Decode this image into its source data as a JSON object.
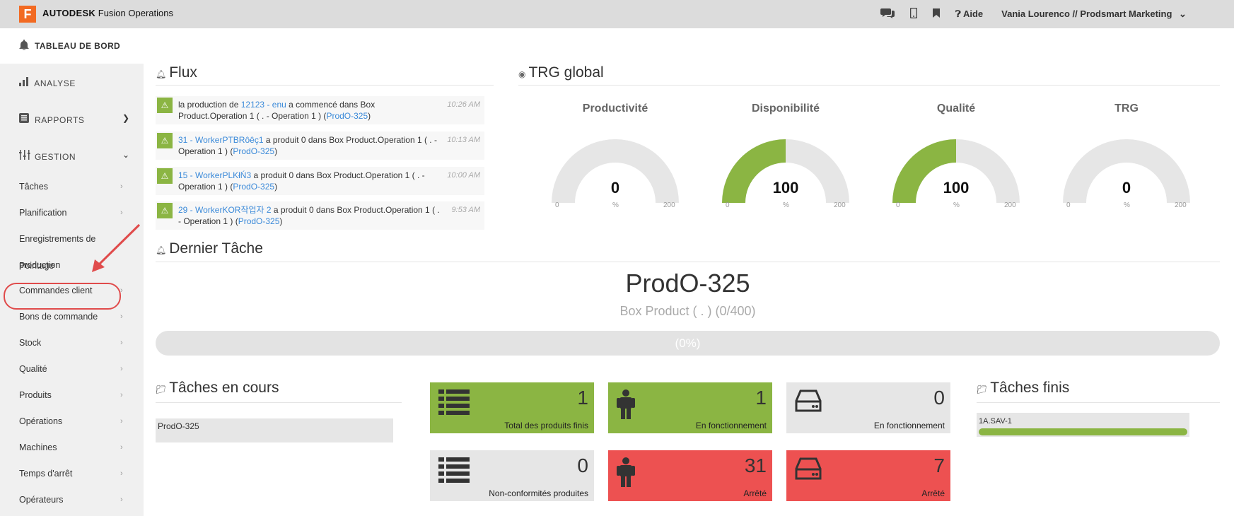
{
  "topbar": {
    "logo_letter": "F",
    "brand_bold": "AUTODESK",
    "brand_rest": "Fusion Operations",
    "help_label": "Aide",
    "user_label": "Vania Lourenco // Prodsmart Marketing",
    "icons": [
      "chat-icon",
      "mobile-icon",
      "bookmark-icon",
      "help-icon",
      "chevron-down-icon"
    ]
  },
  "subheader": {
    "title": "TABLEAU DE BORD"
  },
  "sidebar": {
    "sections": [
      {
        "label": "ANALYSE",
        "icon": "bar-chart-icon"
      },
      {
        "label": "RAPPORTS",
        "icon": "report-icon"
      },
      {
        "label": "GESTION",
        "icon": "sliders-icon"
      }
    ],
    "items": [
      "Tâches",
      "Planification",
      "Enregistrements de",
      "production",
      "Pointage",
      "Commandes client",
      "Bons de commande",
      "Stock",
      "Qualité",
      "Produits",
      "Opérations",
      "Machines",
      "Temps d'arrêt",
      "Opérateurs"
    ]
  },
  "flux": {
    "title": "Flux",
    "items": [
      {
        "pre": "la production de ",
        "link1": "12123 - enu",
        "mid": " a commencé dans Box Product.Operation 1 ( . - Operation 1 ) (",
        "link2": "ProdO-325",
        "post": ")",
        "time": "10:26 AM"
      },
      {
        "pre": "",
        "link1": "31 - WorkerPTBRôêç1",
        "mid": " a produit 0 dans Box Product.Operation 1 ( . - Operation 1 ) (",
        "link2": "ProdO-325",
        "post": ")",
        "time": "10:13 AM"
      },
      {
        "pre": "",
        "link1": "15 - WorkerPLKłŃ3",
        "mid": " a produit 0 dans Box Product.Operation 1 ( . - Operation 1 ) (",
        "link2": "ProdO-325",
        "post": ")",
        "time": "10:00 AM"
      },
      {
        "pre": "",
        "link1": "29 - WorkerKOR작업자 2",
        "mid": " a produit 0 dans Box Product.Operation 1 ( . - Operation 1 ) (",
        "link2": "ProdO-325",
        "post": ")",
        "time": "9:53 AM"
      }
    ]
  },
  "trg": {
    "title": "TRG global",
    "gauges": [
      {
        "title": "Productivité",
        "value": "0",
        "value_num": 0,
        "min": "0",
        "max": "200",
        "unit": "%"
      },
      {
        "title": "Disponibilité",
        "value": "100",
        "value_num": 100,
        "min": "0",
        "max": "200",
        "unit": "%"
      },
      {
        "title": "Qualité",
        "value": "100",
        "value_num": 100,
        "min": "0",
        "max": "200",
        "unit": "%"
      },
      {
        "title": "TRG",
        "value": "0",
        "value_num": 0,
        "min": "0",
        "max": "200",
        "unit": "%"
      }
    ]
  },
  "dernier": {
    "title": "Dernier Tâche",
    "job": "ProdO-325",
    "product": "Box Product ( . ) (0/400)",
    "progress_text": "(0%)",
    "progress_fraction": 0
  },
  "en_cours": {
    "title": "Tâches en cours",
    "items": [
      "ProdO-325"
    ]
  },
  "tiles": [
    {
      "value": "1",
      "label": "Total des produits finis",
      "color": "green",
      "icon": "list-icon"
    },
    {
      "value": "1",
      "label": "En fonctionnement",
      "color": "green",
      "icon": "person-icon"
    },
    {
      "value": "0",
      "label": "En fonctionnement",
      "color": "gray",
      "icon": "drive-icon"
    },
    {
      "value": "0",
      "label": "Non-conformités produites",
      "color": "gray",
      "icon": "list-icon"
    },
    {
      "value": "31",
      "label": "Arrêté",
      "color": "red",
      "icon": "person-icon"
    },
    {
      "value": "7",
      "label": "Arrêté",
      "color": "red",
      "icon": "drive-icon"
    }
  ],
  "finis": {
    "title": "Tâches finis",
    "items": [
      {
        "label": "1A.SAV-1",
        "progress_fraction": 1
      }
    ]
  },
  "colors": {
    "green": "#8bb543",
    "red": "#ed5151",
    "gray": "#e6e6e6",
    "link": "#3b8ad9",
    "orange": "#f26a22"
  }
}
